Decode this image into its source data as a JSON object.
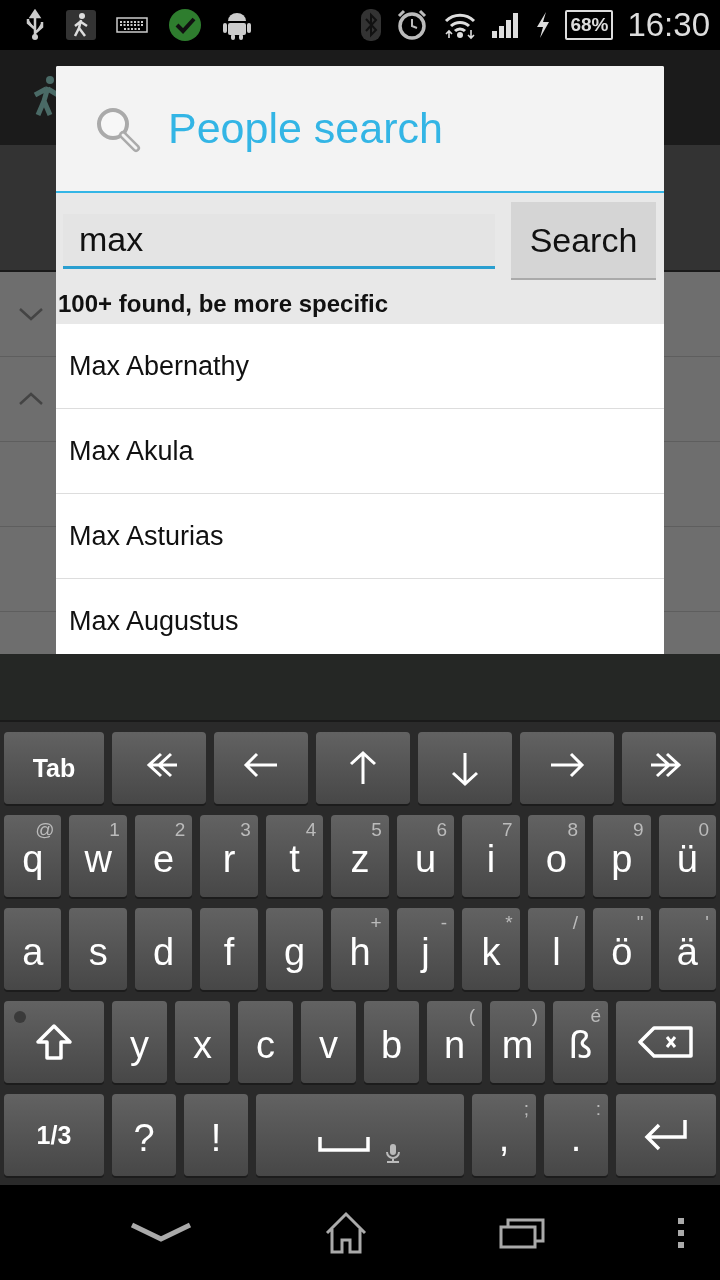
{
  "status_bar": {
    "battery": "68%",
    "time": "16:30"
  },
  "dialog": {
    "title": "People search",
    "search_field": {
      "value": "max"
    },
    "search_button": "Search",
    "result_message": "100+ found, be more specific",
    "results": [
      "Max Abernathy",
      "Max Akula",
      "Max Asturias",
      "Max Augustus"
    ]
  },
  "keyboard": {
    "rows": [
      [
        {
          "kind": "function",
          "label": "Tab"
        },
        {
          "kind": "double-left"
        },
        {
          "kind": "left"
        },
        {
          "kind": "up"
        },
        {
          "kind": "down"
        },
        {
          "kind": "right"
        },
        {
          "kind": "double-right"
        }
      ],
      [
        {
          "kind": "text",
          "label": "q",
          "hint": "@"
        },
        {
          "kind": "text",
          "label": "w",
          "hint": "1"
        },
        {
          "kind": "text",
          "label": "e",
          "hint": "2"
        },
        {
          "kind": "text",
          "label": "r",
          "hint": "3"
        },
        {
          "kind": "text",
          "label": "t",
          "hint": "4"
        },
        {
          "kind": "text",
          "label": "z",
          "hint": "5"
        },
        {
          "kind": "text",
          "label": "u",
          "hint": "6"
        },
        {
          "kind": "text",
          "label": "i",
          "hint": "7"
        },
        {
          "kind": "text",
          "label": "o",
          "hint": "8"
        },
        {
          "kind": "text",
          "label": "p",
          "hint": "9"
        },
        {
          "kind": "text",
          "label": "ü",
          "hint": "0"
        }
      ],
      [
        {
          "kind": "text",
          "label": "a"
        },
        {
          "kind": "text",
          "label": "s"
        },
        {
          "kind": "text",
          "label": "d"
        },
        {
          "kind": "text",
          "label": "f"
        },
        {
          "kind": "text",
          "label": "g"
        },
        {
          "kind": "text",
          "label": "h",
          "hint": "+"
        },
        {
          "kind": "text",
          "label": "j",
          "hint": "-"
        },
        {
          "kind": "text",
          "label": "k",
          "hint": "*"
        },
        {
          "kind": "text",
          "label": "l",
          "hint": "/"
        },
        {
          "kind": "text",
          "label": "ö",
          "hint": "\""
        },
        {
          "kind": "text",
          "label": "ä",
          "hint": "'"
        }
      ],
      [
        {
          "kind": "shift"
        },
        {
          "kind": "text",
          "label": "y"
        },
        {
          "kind": "text",
          "label": "x"
        },
        {
          "kind": "text",
          "label": "c"
        },
        {
          "kind": "text",
          "label": "v"
        },
        {
          "kind": "text",
          "label": "b"
        },
        {
          "kind": "text",
          "label": "n",
          "hint": "("
        },
        {
          "kind": "text",
          "label": "m",
          "hint": ")"
        },
        {
          "kind": "text",
          "label": "ß",
          "hint": "é"
        },
        {
          "kind": "backspace"
        }
      ],
      [
        {
          "kind": "function",
          "label": "1/3"
        },
        {
          "kind": "text",
          "label": "?"
        },
        {
          "kind": "text",
          "label": "!"
        },
        {
          "kind": "space"
        },
        {
          "kind": "text",
          "label": ",",
          "hint": ";"
        },
        {
          "kind": "text",
          "label": ".",
          "hint": ":"
        },
        {
          "kind": "enter"
        }
      ]
    ]
  }
}
